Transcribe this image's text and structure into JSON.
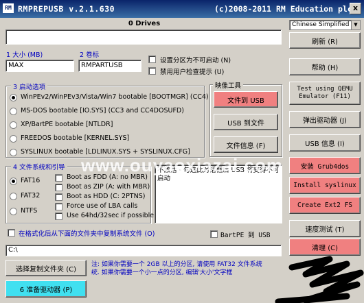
{
  "window": {
    "app_title": "RMPREPUSB v.2.1.630",
    "copyright": "(c)2008-2011 RM Education plc",
    "icon_text": "RM",
    "close_label": "x"
  },
  "drives_header": "0 Drives",
  "language": "Chinese Simplified",
  "fields": {
    "size_label": "1 大小 (MB)",
    "size_value": "MAX",
    "volume_label": "2 卷标",
    "volume_value": "RMPARTUSB"
  },
  "options": {
    "non_bootable": "设置分区为不可启动 (N)",
    "disable_prompts": "禁用用户检查提示 (U)"
  },
  "boot": {
    "title": "3 启动选项",
    "items": [
      {
        "label": "WinPEv2/WinPEv3/Vista/Win7 bootable [BOOTMGR] (CC4)",
        "selected": true
      },
      {
        "label": "MS-DOS bootable [IO.SYS]    (CC3 and CC4DOSUFD)",
        "selected": false
      },
      {
        "label": "XP/BartPE bootable [NTLDR]",
        "selected": false
      },
      {
        "label": "FREEDOS bootable [KERNEL.SYS]",
        "selected": false
      },
      {
        "label": "SYSLINUX bootable [LDLINUX.SYS + SYSLINUX.CFG]",
        "selected": false
      }
    ]
  },
  "tools": {
    "title": "映像工具",
    "file_to_usb": "文件到 USB",
    "usb_to_file": "USB 到文件",
    "file_info": "文件信息 (F)"
  },
  "fs": {
    "title": "4 文件系统和引导",
    "fat16": "FAT16",
    "fat32": "FAT32",
    "ntfs": "NTFS",
    "fdd": "Boot as FDD (A: no MBR)",
    "zip": "Boot as ZIP (A: with MBR)",
    "hdd": "Boot as HDD (C: 2PTNS)",
    "lba": "Force use of LBA calls",
    "use64": "Use 64hd/32sec if possible"
  },
  "info_text": "不激活 - 勾选此对话框后 USB 将变得不可启动",
  "copy_files": "在格式化后从下面的文件夹中复制系统文件 (O)",
  "bartpe": "BartPE 到 USB",
  "path_value": "C:\\",
  "choose_folder": "选择复制文件夹 (C)",
  "note_line1": "注: 如果你需要一个 2GB 以上的分区, 请使用 FAT32 文件系统",
  "note_line2": "统. 如果你需要一个小一点的分区, 编辑'大小'文字框",
  "prepare": "6 准备驱动器 (P)",
  "right": {
    "refresh": "刷新 (R)",
    "help": "帮助 (H)",
    "qemu_line1": "Test using QEMU",
    "qemu_line2": "Emulator (F11)",
    "eject": "弹出驱动器 (J)",
    "usb_info": "USB 信息 (I)",
    "grub": "安装 Grub4dos",
    "syslinux": "Install syslinux",
    "ext2": "Create Ext2 FS",
    "speed": "速度测试 (T)",
    "clean": "清理 (C)"
  },
  "watermark": "www.ouyaoxiazai.com"
}
